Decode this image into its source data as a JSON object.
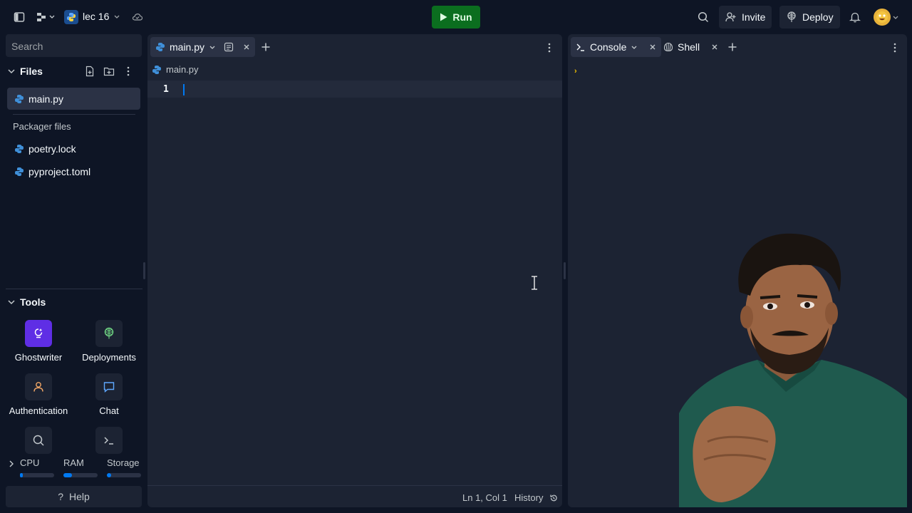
{
  "topbar": {
    "repl_name": "lec 16",
    "run_label": "Run",
    "invite_label": "Invite",
    "deploy_label": "Deploy"
  },
  "sidebar": {
    "search_placeholder": "Search",
    "files_title": "Files",
    "files": [
      {
        "name": "main.py"
      }
    ],
    "packager_label": "Packager files",
    "packager_files": [
      {
        "name": "poetry.lock"
      },
      {
        "name": "pyproject.toml"
      }
    ],
    "tools_title": "Tools",
    "tools": [
      {
        "label": "Ghostwriter"
      },
      {
        "label": "Deployments"
      },
      {
        "label": "Authentication"
      },
      {
        "label": "Chat"
      }
    ],
    "resources": [
      {
        "label": "CPU",
        "usage": 0.08
      },
      {
        "label": "RAM",
        "usage": 0.25
      },
      {
        "label": "Storage",
        "usage": 0.12
      }
    ],
    "help_label": "Help"
  },
  "editor": {
    "tab_label": "main.py",
    "breadcrumb": "main.py",
    "line_number": "1",
    "status_position": "Ln 1, Col 1",
    "history_label": "History"
  },
  "console": {
    "tabs": [
      {
        "label": "Console"
      },
      {
        "label": "Shell"
      }
    ],
    "prompt": "›"
  },
  "colors": {
    "background": "#0e1525",
    "surface": "#1c2333",
    "run_green": "#0b6e1f",
    "accent_blue": "#0079f2",
    "ghostwriter_purple": "#5f2ee5"
  }
}
